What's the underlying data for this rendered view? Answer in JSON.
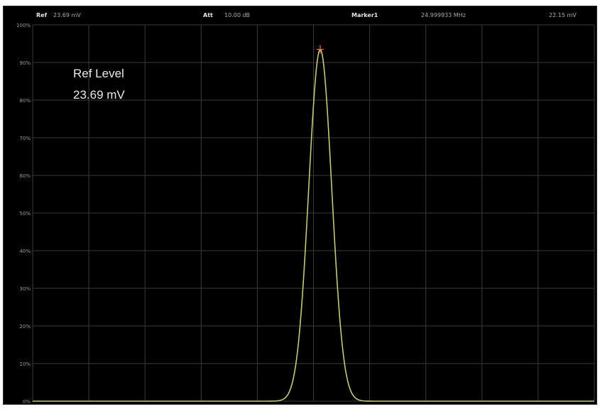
{
  "header": {
    "ref_label": "Ref",
    "ref_value": "23.69 mV",
    "att_label": "Att",
    "att_value": "10.00 dB",
    "marker_label": "Marker1",
    "marker_freq": "24.999933 MHz",
    "marker_value": "22.15 mV"
  },
  "annotation": {
    "line1": "Ref Level",
    "line2": "23.69 mV"
  },
  "colors": {
    "background": "#000000",
    "grid": "#3a3a3a",
    "trace": "#c8c87a",
    "marker": "#ff6a5a"
  },
  "chart_data": {
    "type": "line",
    "ylim": [
      0,
      100
    ],
    "y_ticks": [
      "0%",
      "10%",
      "20%",
      "30%",
      "40%",
      "50%",
      "60%",
      "70%",
      "80%",
      "90%",
      "100%"
    ],
    "x_divisions": 10,
    "grid": true,
    "series": [
      {
        "peak_position_fraction": 0.512,
        "peak_percent": 93.5,
        "half_width_fraction": 0.045
      }
    ],
    "marker": {
      "position_fraction": 0.512,
      "percent": 93.5
    }
  }
}
